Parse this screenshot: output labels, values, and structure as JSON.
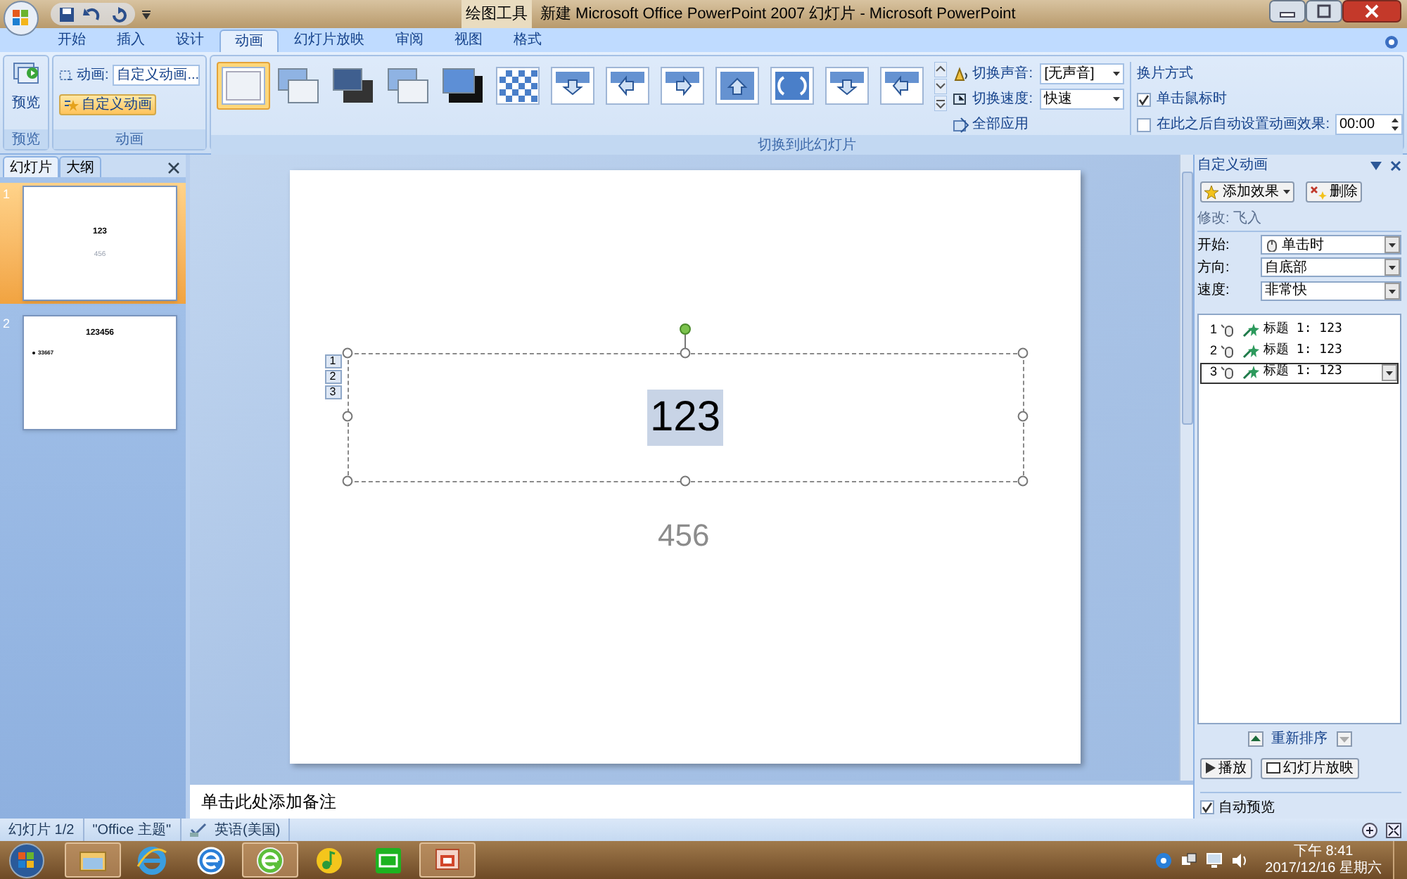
{
  "window": {
    "title": "新建 Microsoft Office PowerPoint 2007 幻灯片 - Microsoft PowerPoint",
    "context_group": "绘图工具"
  },
  "ribbon_tabs": [
    {
      "label": "开始",
      "selected": false
    },
    {
      "label": "插入",
      "selected": false
    },
    {
      "label": "设计",
      "selected": false
    },
    {
      "label": "动画",
      "selected": true
    },
    {
      "label": "幻灯片放映",
      "selected": false
    },
    {
      "label": "审阅",
      "selected": false
    },
    {
      "label": "视图",
      "selected": false
    },
    {
      "label": "格式",
      "selected": false
    }
  ],
  "preview_group": {
    "button": "预览",
    "label": "预览"
  },
  "animation_group": {
    "field_label": "动画:",
    "field_value": "自定义动画...",
    "custom_button": "自定义动画",
    "label": "动画"
  },
  "transition_group": {
    "label": "切换到此幻灯片",
    "effects": [
      {
        "kind": "blank",
        "selected": true
      },
      {
        "kind": "stack-light",
        "selected": false
      },
      {
        "kind": "stack-dark",
        "selected": false
      },
      {
        "kind": "stack-light",
        "selected": false
      },
      {
        "kind": "stack-black",
        "selected": false
      },
      {
        "kind": "checker",
        "selected": false
      },
      {
        "kind": "arrow-down",
        "selected": false
      },
      {
        "kind": "arrow-left",
        "selected": false
      },
      {
        "kind": "arrow-right",
        "selected": false
      },
      {
        "kind": "arrow-up",
        "selected": false
      },
      {
        "kind": "wheel",
        "selected": false
      },
      {
        "kind": "arrow-down",
        "selected": false
      },
      {
        "kind": "arrow-left",
        "selected": false
      }
    ],
    "sound": {
      "label": "切换声音:",
      "value": "[无声音]"
    },
    "speed": {
      "label": "切换速度:",
      "value": "快速"
    },
    "apply_all": "全部应用"
  },
  "advance_group": {
    "title": "换片方式",
    "on_click": {
      "label": "单击鼠标时",
      "checked": true
    },
    "after": {
      "label": "在此之后自动设置动画效果:",
      "checked": false,
      "value": "00:00"
    }
  },
  "slides_panel": {
    "tabs": [
      {
        "label": "幻灯片",
        "selected": true
      },
      {
        "label": "大纲",
        "selected": false
      }
    ],
    "slides": [
      {
        "number": "1",
        "title": "123",
        "body": "456",
        "selected": true
      },
      {
        "number": "2",
        "title": "123456",
        "bullet": "33667",
        "selected": false
      }
    ]
  },
  "slide": {
    "title": "123",
    "subtitle": "456",
    "animation_tags": [
      "1",
      "2",
      "3"
    ]
  },
  "notes": {
    "placeholder": "单击此处添加备注"
  },
  "task_pane": {
    "title": "自定义动画",
    "add_button": "添加效果",
    "remove_button": "删除",
    "modify": "修改: 飞入",
    "fields": [
      {
        "label": "开始:",
        "value": "单击时",
        "mouse": true
      },
      {
        "label": "方向:",
        "value": "自底部",
        "mouse": false
      },
      {
        "label": "速度:",
        "value": "非常快",
        "mouse": false
      }
    ],
    "effects": [
      {
        "number": "1",
        "label": "标题 1: 123",
        "selected": false
      },
      {
        "number": "2",
        "label": "标题 1: 123",
        "selected": false
      },
      {
        "number": "3",
        "label": "标题 1: 123",
        "selected": true
      }
    ],
    "reorder": "重新排序",
    "play_button": "播放",
    "slideshow_button": "幻灯片放映",
    "autopreview": {
      "label": "自动预览",
      "checked": true
    }
  },
  "status_bar": [
    "幻灯片 1/2",
    "\"Office 主题\"",
    "英语(美国)"
  ],
  "taskbar": {
    "apps": [
      {
        "kind": "folder",
        "open": true
      },
      {
        "kind": "e-blue",
        "open": false
      },
      {
        "kind": "e-round",
        "open": false
      },
      {
        "kind": "e-green",
        "open": true
      },
      {
        "kind": "note",
        "open": false
      },
      {
        "kind": "tv",
        "open": false
      },
      {
        "kind": "slides",
        "open": true
      }
    ],
    "time": "下午 8:41",
    "date": "2017/12/16 星期六"
  }
}
